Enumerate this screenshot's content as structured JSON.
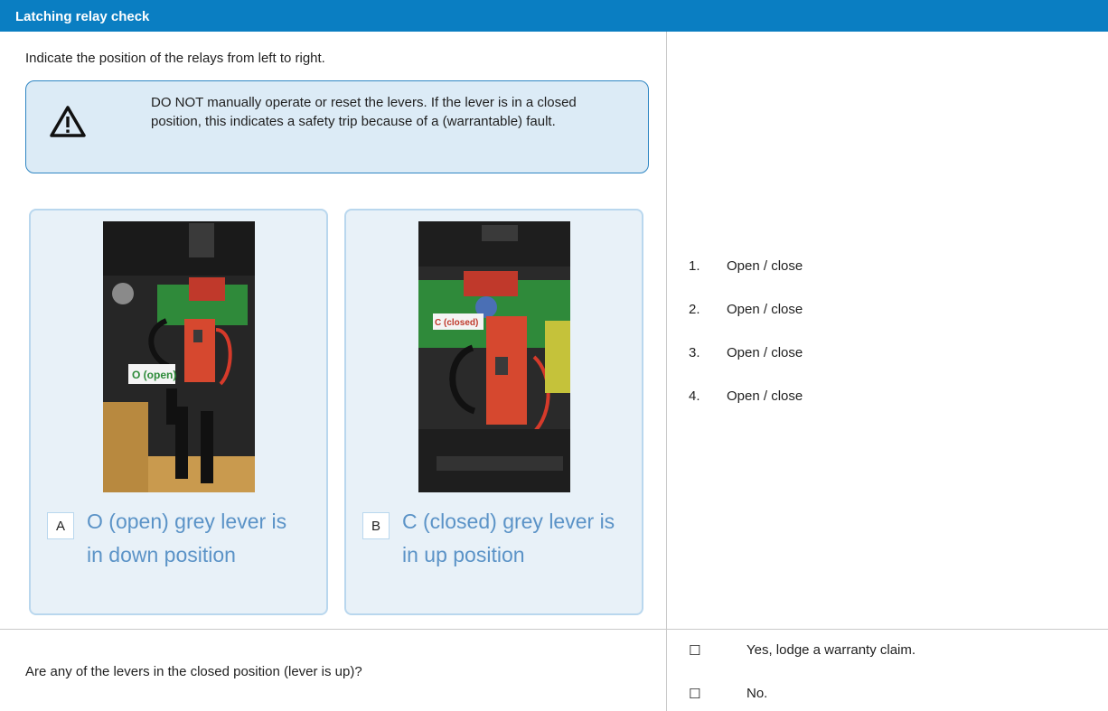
{
  "header": {
    "title": "Latching relay check"
  },
  "intro": "Indicate the position of the relays from left to right.",
  "warning": {
    "icon": "warning-triangle-icon",
    "text": "DO NOT manually operate or reset the levers. If the lever is in a closed position, this indicates a safety trip because of a (warrantable) fault."
  },
  "figures": [
    {
      "letter": "A",
      "photo_label": "O (open)",
      "caption": "O (open) grey lever is in down position"
    },
    {
      "letter": "B",
      "photo_label": "C (closed)",
      "caption": "C (closed) grey lever is in up position"
    }
  ],
  "relay_list": [
    {
      "num": "1.",
      "text": "Open / close"
    },
    {
      "num": "2.",
      "text": "Open / close"
    },
    {
      "num": "3.",
      "text": "Open / close"
    },
    {
      "num": "4.",
      "text": "Open / close"
    }
  ],
  "question": "Are any of the levers in the closed position (lever is up)?",
  "options": [
    {
      "box": "☐",
      "text": "Yes, lodge a warranty claim."
    },
    {
      "box": "☐",
      "text": "No."
    }
  ]
}
